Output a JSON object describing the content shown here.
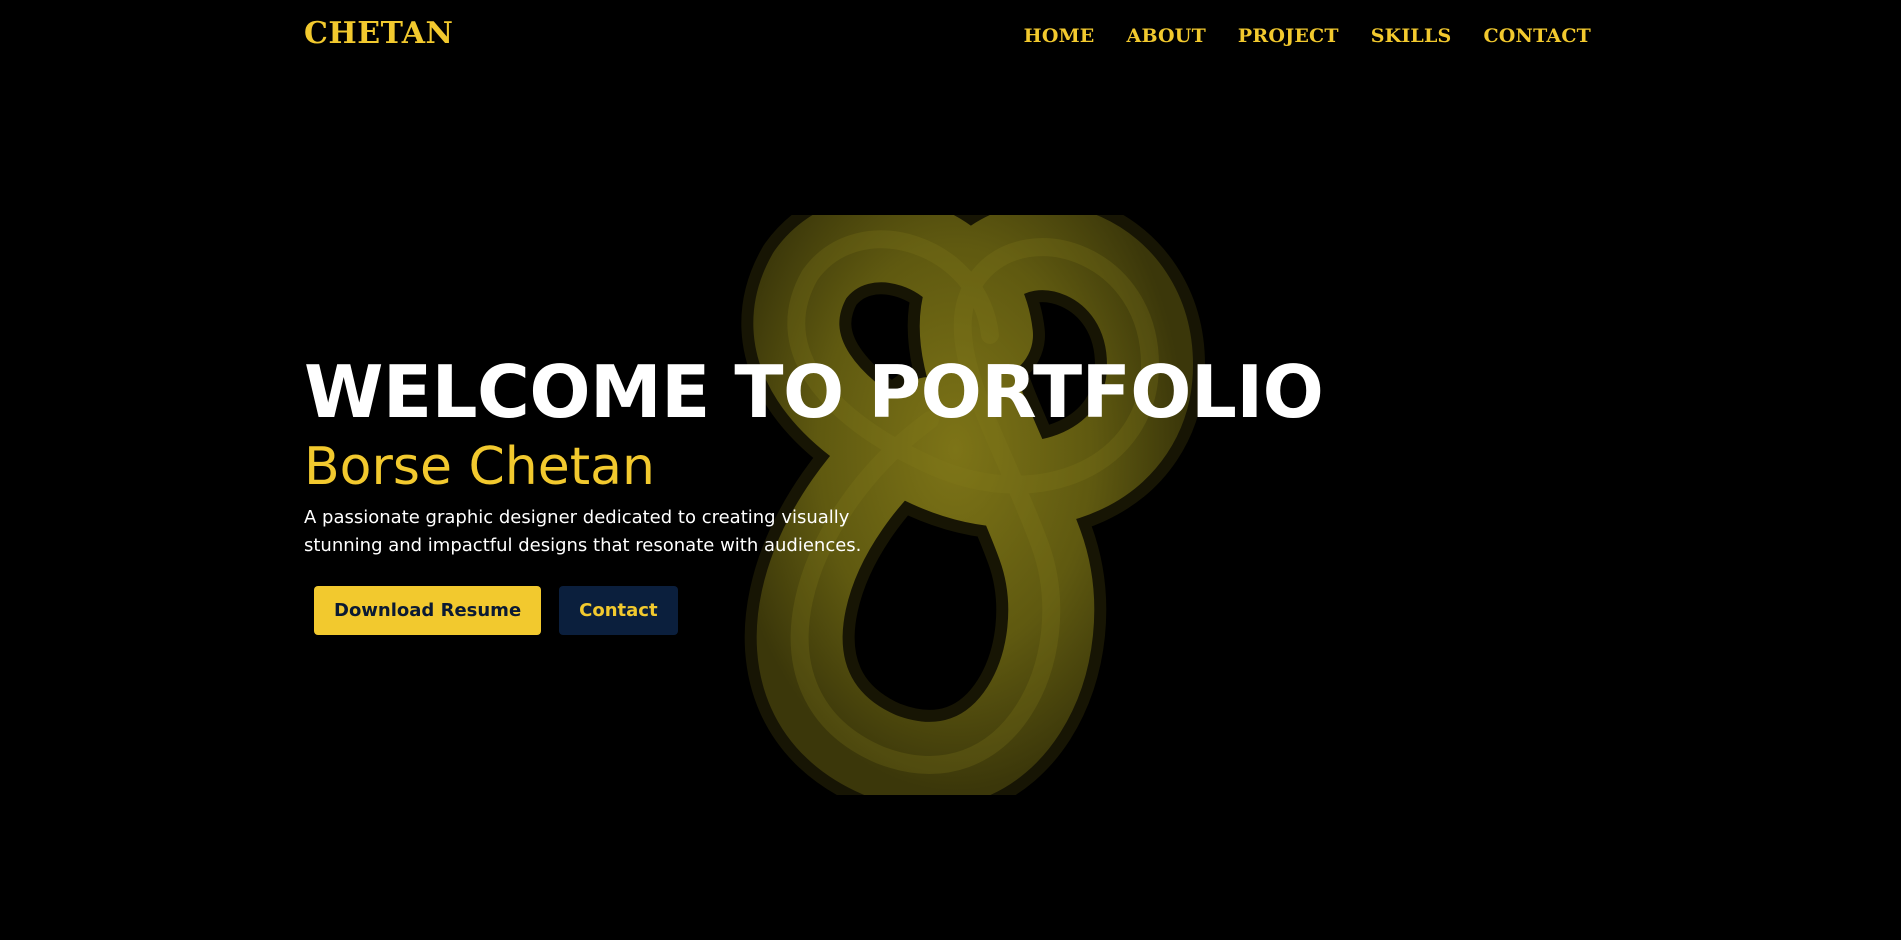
{
  "brand": {
    "logo_text": "CHETAN"
  },
  "nav": {
    "items": [
      {
        "label": "HOME"
      },
      {
        "label": "ABOUT"
      },
      {
        "label": "PROJECT"
      },
      {
        "label": "SKILLS"
      },
      {
        "label": "CONTACT"
      }
    ]
  },
  "hero": {
    "title": "WELCOME TO PORTFOLIO",
    "name": "Borse Chetan",
    "description": "A passionate graphic designer dedicated to creating visually stunning and impactful designs that resonate with audiences.",
    "primary_button": "Download Resume",
    "secondary_button": "Contact"
  },
  "colors": {
    "background": "#000000",
    "accent": "#f2c92e",
    "text": "#ffffff",
    "secondary_button_bg": "#0b1f3d",
    "knot": "#6b6512"
  },
  "decoration": {
    "background_graphic": "torus-knot"
  }
}
